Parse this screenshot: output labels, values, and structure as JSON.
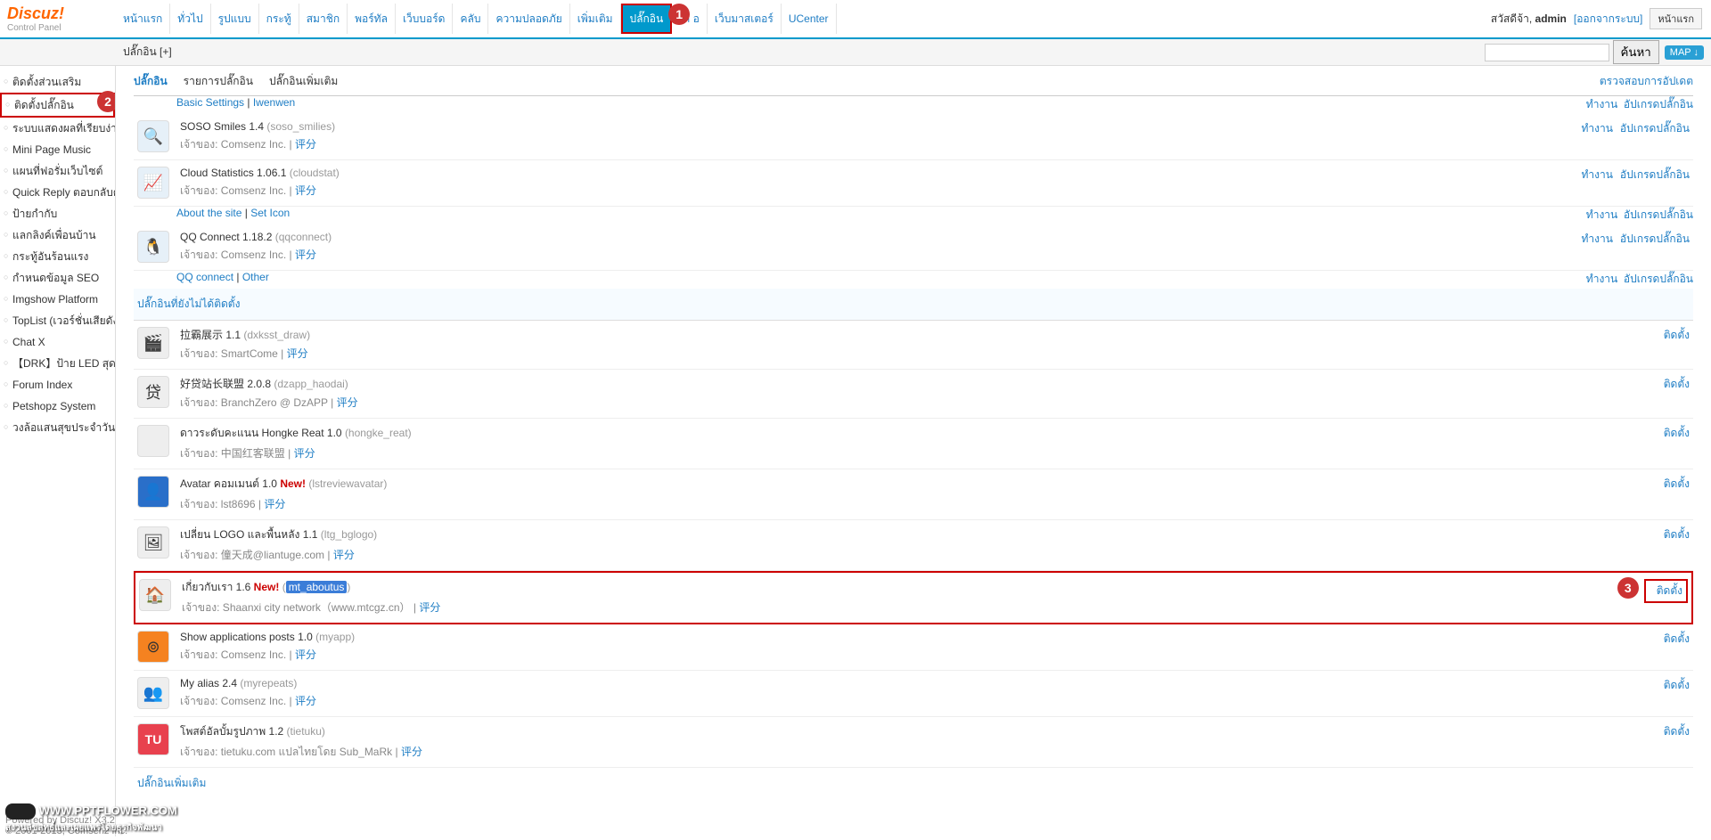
{
  "header": {
    "logo": "Discuz",
    "logo_punct": "!",
    "logo_sub": "Control Panel",
    "nav": [
      "หน้าแรก",
      "ทั่วไป",
      "รูปแบบ",
      "กระทู้",
      "สมาชิก",
      "พอร์ทัล",
      "เว็บบอร์ด",
      "คลับ",
      "ความปลอดภัย",
      "เพิ่มเติม",
      "ปลั๊กอิน",
      "เค    อ",
      "เว็บมาสเตอร์",
      "UCenter"
    ],
    "nav_active": 10,
    "welcome_prefix": "สวัสดีจ้า, ",
    "username": "admin",
    "logout": "[ออกจากระบบ]",
    "homepage": "หน้าแรก"
  },
  "subheader": {
    "crumb": "ปลั๊กอิน  [+]",
    "search_btn": "ค้นหา",
    "map_btn": "MAP ↓"
  },
  "sidebar": [
    "ติดตั้งส่วนเสริม",
    "ติดตั้งปลั๊กอิน",
    "ระบบแสดงผลที่เรียบง่าย",
    "Mini Page Music",
    "แผนที่ฟอรั่มเว็บไซต์",
    "Quick Reply ตอบกลับด่",
    "ป้ายกำกับ",
    "แลกลิงค์เพื่อนบ้าน",
    "กระทู้อันร้อนแรง",
    "กำหนดข้อมูล SEO",
    "Imgshow Platform",
    "TopList (เวอร์ชั่นเสียดัง)",
    "Chat X",
    "【DRK】ป้าย LED สุดส",
    "Forum Index",
    "Petshopz System",
    "วงล้อแสนสุขประจำวัน"
  ],
  "sidebar_selected": 1,
  "tabs": {
    "items": [
      "ปลั๊กอิน",
      "รายการปลั๊กอิน",
      "ปลั๊กอินเพิ่มเติม"
    ],
    "active": 0,
    "check_update": "ตรวจสอบการอัปเดต"
  },
  "links_row1": {
    "a": "Basic Settings",
    "sep": " | ",
    "b": "Iwenwen"
  },
  "links_row2": {
    "a": "About the site",
    "sep": " | ",
    "b": "Set Icon"
  },
  "links_row3": {
    "a": "QQ connect",
    "sep": " | ",
    "b": "Other"
  },
  "owner_prefix": "เจ้าของ: ",
  "sep_pipe": " | ",
  "rate_label": "评分",
  "action": {
    "work": "ทำงาน",
    "upgrade": "อัปเกรดปลั๊กอิน",
    "install": "ติดตั้ง"
  },
  "plugins_installed": [
    {
      "name": "SOSO Smiles",
      "ver": "1.4",
      "slug": "soso_smilies",
      "owner": "Comsenz Inc.",
      "icon": "🔍"
    },
    {
      "name": "Cloud Statistics",
      "ver": "1.06.1",
      "slug": "cloudstat",
      "owner": "Comsenz Inc.",
      "icon": "📈"
    },
    {
      "name": "QQ Connect",
      "ver": "1.18.2",
      "slug": "qqconnect",
      "owner": "Comsenz Inc.",
      "icon": "🐧"
    }
  ],
  "section_not_installed": "ปลั๊กอินที่ยังไม่ได้ติดตั้ง",
  "plugins_notinstalled": [
    {
      "name": "拉霸展示",
      "ver": "1.1",
      "slug": "dxksst_draw",
      "owner": "SmartCome",
      "icon": "🎬"
    },
    {
      "name": "好贷站长联盟",
      "ver": "2.0.8",
      "slug": "dzapp_haodai",
      "owner": "BranchZero @ DzAPP",
      "icon": "贷"
    },
    {
      "name": "ดาวระดับคะแนน Hongke Reat",
      "ver": "1.0",
      "slug": "hongke_reat",
      "owner": "中国红客联盟",
      "icon": ""
    },
    {
      "name": "Avatar คอมเมนต์",
      "ver": "1.0",
      "slug": "lstreviewavatar",
      "owner": "lst8696",
      "icon": "👤",
      "new": "New!"
    },
    {
      "name": "เปลี่ยน LOGO และพื้นหลัง",
      "ver": "1.1",
      "slug": "ltg_bglogo",
      "owner": "僮天成@liantuge.com",
      "icon": "🖼"
    },
    {
      "name": "เกี่ยวกับเรา",
      "ver": "1.6",
      "slug": "mt_aboutus",
      "owner": "Shaanxi city network（www.mtcgz.cn）",
      "icon": "🏠",
      "new": "New!",
      "hl": true
    },
    {
      "name": "Show applications posts",
      "ver": "1.0",
      "slug": "myapp",
      "owner": "Comsenz Inc.",
      "icon": "⊚"
    },
    {
      "name": "My alias",
      "ver": "2.4",
      "slug": "myrepeats",
      "owner": "Comsenz Inc.",
      "icon": "👥"
    },
    {
      "name": "โพสต์อัลบั้มรูปภาพ",
      "ver": "1.2",
      "slug": "tietuku",
      "owner": "tietuku.com แปลไทยโดย Sub_MaRk",
      "icon": "TU"
    }
  ],
  "more_plugins": "ปลั๊กอินเพิ่มเติม",
  "footer1": "Powered by Discuz! X3.2",
  "footer2": "© 2001-2013, Comsenz Inc.",
  "watermark": "WWW.PPTFLOWER.COM",
  "watermark_sub": "สงวนลิขสิทธิ์และเผยแพร่โดยธุรกิจพัฒนา",
  "badge1": "1",
  "badge2": "2",
  "badge3": "3"
}
